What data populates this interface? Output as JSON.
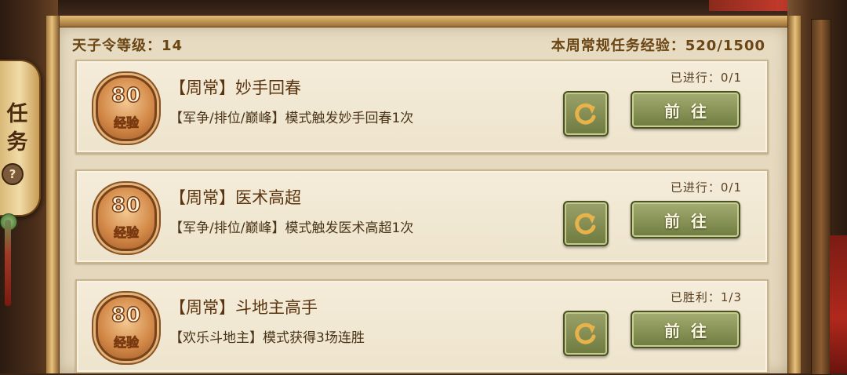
{
  "header": {
    "level_text": "天子令等级：14",
    "weekly_exp_text": "本周常规任务经验：520/1500"
  },
  "side_tab": {
    "label": "任务",
    "help_icon": "?"
  },
  "tasks": [
    {
      "exp_value": "80",
      "exp_label": "经验",
      "title": "【周常】妙手回春",
      "description": "【军争/排位/巅峰】模式触发妙手回春1次",
      "progress": "已进行：0/1",
      "button_label": "前往"
    },
    {
      "exp_value": "80",
      "exp_label": "经验",
      "title": "【周常】医术高超",
      "description": "【军争/排位/巅峰】模式触发医术高超1次",
      "progress": "已进行：0/1",
      "button_label": "前往"
    },
    {
      "exp_value": "80",
      "exp_label": "经验",
      "title": "【周常】斗地主高手",
      "description": "【欢乐斗地主】模式获得3场连胜",
      "progress": "已胜利：1/3",
      "button_label": "前往"
    }
  ],
  "icons": {
    "refresh": "refresh-icon",
    "help": "help-icon"
  },
  "colors": {
    "parchment": "#e7dcc3",
    "gold_frame": "#e7c27c",
    "button_green": "#6f7c3f",
    "medal_orange": "#d48b4a",
    "text_brown": "#6b4614"
  }
}
